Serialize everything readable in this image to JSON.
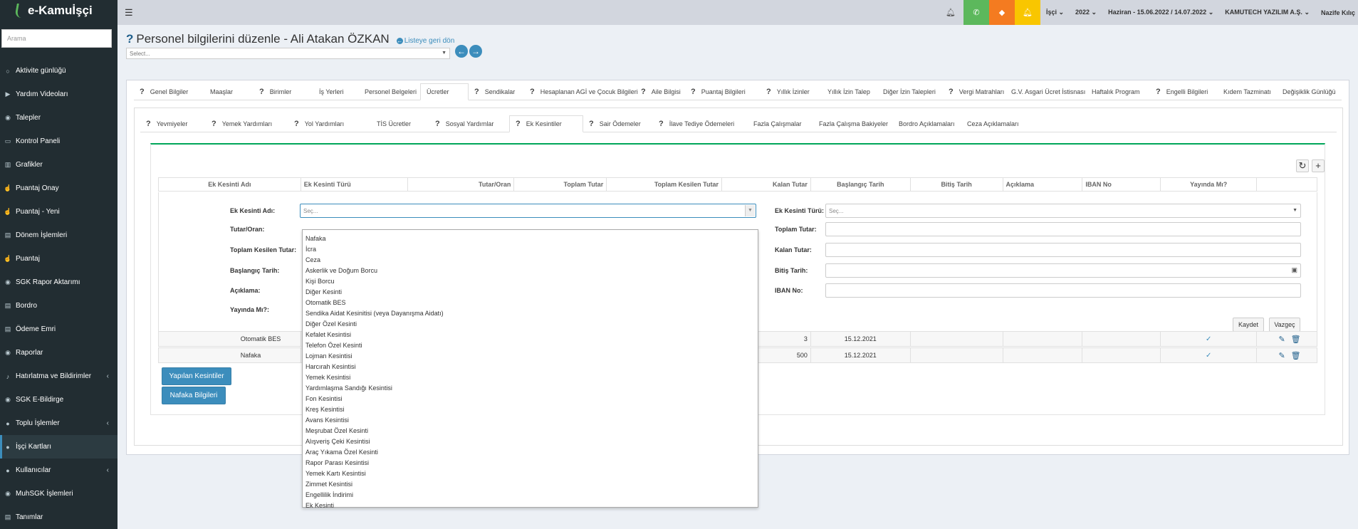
{
  "app": {
    "logo": "e-Kamuİşçi"
  },
  "sidebar": {
    "search_placeholder": "Arama",
    "items": [
      {
        "label": "Aktivite günlüğü",
        "icon": "circle-icon"
      },
      {
        "label": "Yardım Videoları",
        "icon": "video-icon"
      },
      {
        "label": "Talepler",
        "icon": "rss-icon"
      },
      {
        "label": "Kontrol Paneli",
        "icon": "monitor-icon"
      },
      {
        "label": "Grafikler",
        "icon": "bar-chart-icon"
      },
      {
        "label": "Puantaj Onay",
        "icon": "hand-icon"
      },
      {
        "label": "Puantaj - Yeni",
        "icon": "hand-icon"
      },
      {
        "label": "Dönem İşlemleri",
        "icon": "map-icon"
      },
      {
        "label": "Puantaj",
        "icon": "hand-icon"
      },
      {
        "label": "SGK Rapor Aktarımı",
        "icon": "rss-icon"
      },
      {
        "label": "Bordro",
        "icon": "map-icon"
      },
      {
        "label": "Ödeme Emri",
        "icon": "map-icon"
      },
      {
        "label": "Raporlar",
        "icon": "rss-icon"
      },
      {
        "label": "Hatırlatma ve Bildirimler",
        "icon": "bell-icon"
      },
      {
        "label": "SGK E-Bildirge",
        "icon": "rss-icon"
      },
      {
        "label": "Toplu İşlemler",
        "icon": "user-icon"
      },
      {
        "label": "İşçi Kartları",
        "icon": "users-icon"
      },
      {
        "label": "Kullanıcılar",
        "icon": "users-icon"
      },
      {
        "label": "MuhSGK İşlemleri",
        "icon": "rss-icon"
      },
      {
        "label": "Tanımlar",
        "icon": "map-icon"
      }
    ]
  },
  "topbar": {
    "menu_isci": "İşçi",
    "year": "2022",
    "period": "Haziran - 15.06.2022 / 14.07.2022",
    "company": "KAMUTECH YAZILIM A.Ş.",
    "user": "Nazife Kılıç",
    "colors": {
      "phone": "#5cb85c",
      "ticket": "#f47b20",
      "alert": "#f9c600"
    }
  },
  "header": {
    "title": "Personel bilgilerini düzenle - Ali Atakan ÖZKAN",
    "back_link": "Listeye geri dön",
    "select_placeholder": "Select..."
  },
  "tabs_main": [
    {
      "label": "Genel Bilgiler",
      "q": true
    },
    {
      "label": "Maaşlar",
      "q": false
    },
    {
      "label": "Birimler",
      "q": true
    },
    {
      "label": "İş Yerleri",
      "q": false
    },
    {
      "label": "Personel Belgeleri",
      "q": false
    },
    {
      "label": "Ücretler",
      "q": false
    },
    {
      "label": "Sendikalar",
      "q": true
    },
    {
      "label": "Hesaplanan AGİ ve Çocuk Bilgileri",
      "q": true
    },
    {
      "label": "Aile Bilgisi",
      "q": true
    },
    {
      "label": "Puantaj Bilgileri",
      "q": true
    },
    {
      "label": "Yıllık İzinler",
      "q": true
    },
    {
      "label": "Yıllık İzin Talep",
      "q": false
    },
    {
      "label": "Diğer İzin Talepleri",
      "q": false
    },
    {
      "label": "Vergi Matrahları",
      "q": true
    },
    {
      "label": "G.V. Asgari Ücret İstisnası",
      "q": false
    },
    {
      "label": "Haftalık Program",
      "q": false
    },
    {
      "label": "Engelli Bilgileri",
      "q": true
    },
    {
      "label": "Kıdem Tazminatı",
      "q": false
    },
    {
      "label": "Değişiklik Günlüğü",
      "q": false
    }
  ],
  "tabs_sub": [
    {
      "label": "Yevmiyeler",
      "q": true
    },
    {
      "label": "Yemek Yardımları",
      "q": true
    },
    {
      "label": "Yol Yardımları",
      "q": true
    },
    {
      "label": "TİS Ücretler",
      "q": false
    },
    {
      "label": "Sosyal Yardımlar",
      "q": true
    },
    {
      "label": "Ek Kesintiler",
      "q": true
    },
    {
      "label": "Sair Ödemeler",
      "q": true
    },
    {
      "label": "İlave Tediye Ödemeleri",
      "q": true
    },
    {
      "label": "Fazla Çalışmalar",
      "q": false
    },
    {
      "label": "Fazla Çalışma Bakiyeler",
      "q": false
    },
    {
      "label": "Bordro Açıklamaları",
      "q": false
    },
    {
      "label": "Ceza Açıklamaları",
      "q": false
    }
  ],
  "grid": {
    "columns": [
      "Ek Kesinti Adı",
      "Ek Kesinti Türü",
      "Tutar/Oran",
      "Toplam Tutar",
      "Toplam Kesilen Tutar",
      "Kalan Tutar",
      "Başlangıç Tarih",
      "Bitiş Tarih",
      "Açıklama",
      "IBAN No",
      "Yayında Mı?"
    ],
    "rows": [
      {
        "button": "Yapılan Kesintiler",
        "name": "Otomatik BES",
        "kalan": "3",
        "baslangic": "15.12.2021"
      },
      {
        "button": "Nafaka Bilgileri",
        "name": "Nafaka",
        "kalan": "500",
        "baslangic": "15.12.2021"
      }
    ]
  },
  "form": {
    "ek_kesinti_adi": "Ek Kesinti Adı:",
    "ek_kesinti_adi_placeholder": "Seç...",
    "tutar_oran": "Tutar/Oran:",
    "toplam_kesilen": "Toplam Kesilen Tutar:",
    "baslangic": "Başlangıç Tarih:",
    "aciklama": "Açıklama:",
    "yayinda": "Yayında Mı?:",
    "ek_kesinti_turu": "Ek Kesinti Türü:",
    "ek_kesinti_turu_placeholder": "Seç...",
    "toplam_tutar": "Toplam Tutar:",
    "kalan_tutar": "Kalan Tutar:",
    "bitis": "Bitiş Tarih:",
    "iban": "IBAN No:",
    "save": "Kaydet",
    "cancel": "Vazgeç"
  },
  "dropdown_options": [
    "Nafaka",
    "İcra",
    "Ceza",
    "Askerlik ve Doğum Borcu",
    "Kişi Borcu",
    "Diğer Kesinti",
    "Otomatik BES",
    "Sendika Aidat Kesinitisi (veya Dayanışma Aidatı)",
    "Diğer Özel Kesinti",
    "Kefalet Kesintisi",
    "Telefon Özel Kesinti",
    "Lojman Kesintisi",
    "Harcırah Kesintisi",
    "Yemek Kesintisi",
    "Yardımlaşma Sandığı Kesintisi",
    "Fon Kesintisi",
    "Kreş Kesintisi",
    "Avans Kesintisi",
    "Meşrubat Özel Kesinti",
    "Alışveriş Çeki Kesintisi",
    "Araç Yıkama Özel Kesinti",
    "Rapor Parası Kesintisi",
    "Yemek Kartı Kesintisi",
    "Zimmet Kesintisi",
    "Engellilik İndirimi",
    "Ek Kesinti"
  ]
}
